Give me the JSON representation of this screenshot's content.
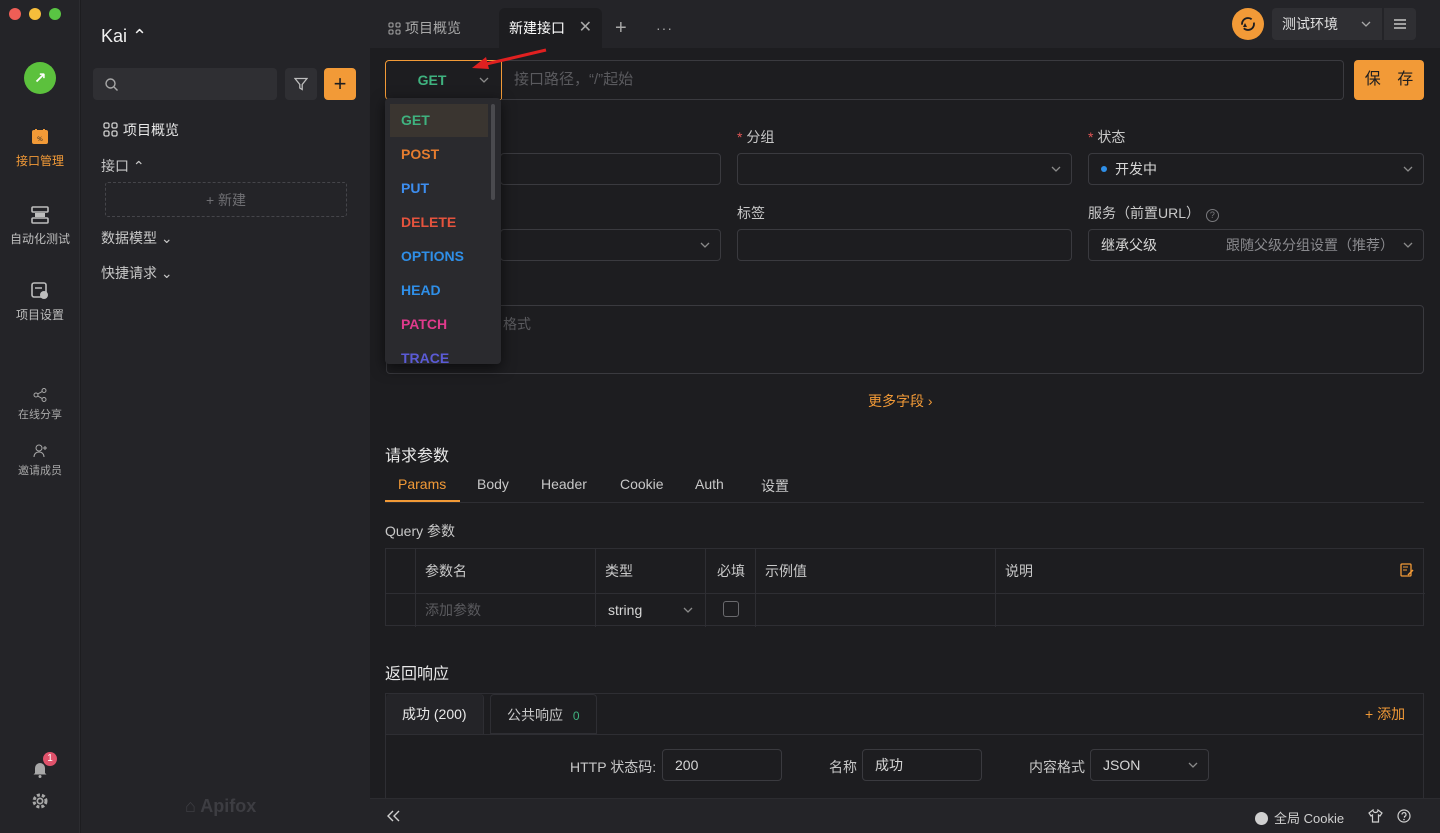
{
  "sidebar": {
    "project_name": "Kai ⌃",
    "overview": "项目概览",
    "api_group": "接口 ⌃",
    "new_item": "+ 新建",
    "data_model": "数据模型 ⌄",
    "quick_request": "快捷请求 ⌄",
    "brand": "Apifox"
  },
  "rail": {
    "api_mgmt": "接口管理",
    "auto_test": "自动化测试",
    "proj_settings": "项目设置",
    "share": "在线分享",
    "invite": "邀请成员",
    "notification_count": "1"
  },
  "tabs": {
    "overview": "项目概览",
    "new_api": "新建接口"
  },
  "env": {
    "selected": "测试环境"
  },
  "request": {
    "method": "GET",
    "url_placeholder": "接口路径，“/”起始",
    "save_label": "保 存"
  },
  "methods": [
    {
      "label": "GET",
      "color": "#3fb27f"
    },
    {
      "label": "POST",
      "color": "#e57c2f"
    },
    {
      "label": "PUT",
      "color": "#3d8ef0"
    },
    {
      "label": "DELETE",
      "color": "#e5533d"
    },
    {
      "label": "OPTIONS",
      "color": "#2f8fe8"
    },
    {
      "label": "HEAD",
      "color": "#2f8fe8"
    },
    {
      "label": "PATCH",
      "color": "#e03a8c"
    },
    {
      "label": "TRACE",
      "color": "#5b5bd6"
    }
  ],
  "form": {
    "group_label": "分组",
    "status_label": "状态",
    "status_value": "开发中",
    "tag_label": "标签",
    "service_label": "服务（前置URL）",
    "service_value": "继承父级",
    "service_hint": "跟随父级分组设置（推荐）",
    "desc_hint": "格式",
    "more_fields": "更多字段 ›"
  },
  "params": {
    "title": "请求参数",
    "tabs": [
      "Params",
      "Body",
      "Header",
      "Cookie",
      "Auth",
      "设置"
    ],
    "query_title": "Query 参数",
    "columns": [
      "参数名",
      "类型",
      "必填",
      "示例值",
      "说明"
    ],
    "row_placeholder": "添加参数",
    "row_type": "string"
  },
  "response": {
    "title": "返回响应",
    "tab_success": "成功 (200)",
    "tab_common": "公共响应",
    "tab_common_count": "0",
    "add_label": "+ 添加",
    "status_code_label": "HTTP 状态码:",
    "status_code_value": "200",
    "name_label": "名称",
    "name_value": "成功",
    "content_type_label": "内容格式",
    "content_type_value": "JSON"
  },
  "footer": {
    "cookie": "全局 Cookie"
  },
  "colors": {
    "accent": "#f29a37",
    "get": "#3fb27f"
  }
}
